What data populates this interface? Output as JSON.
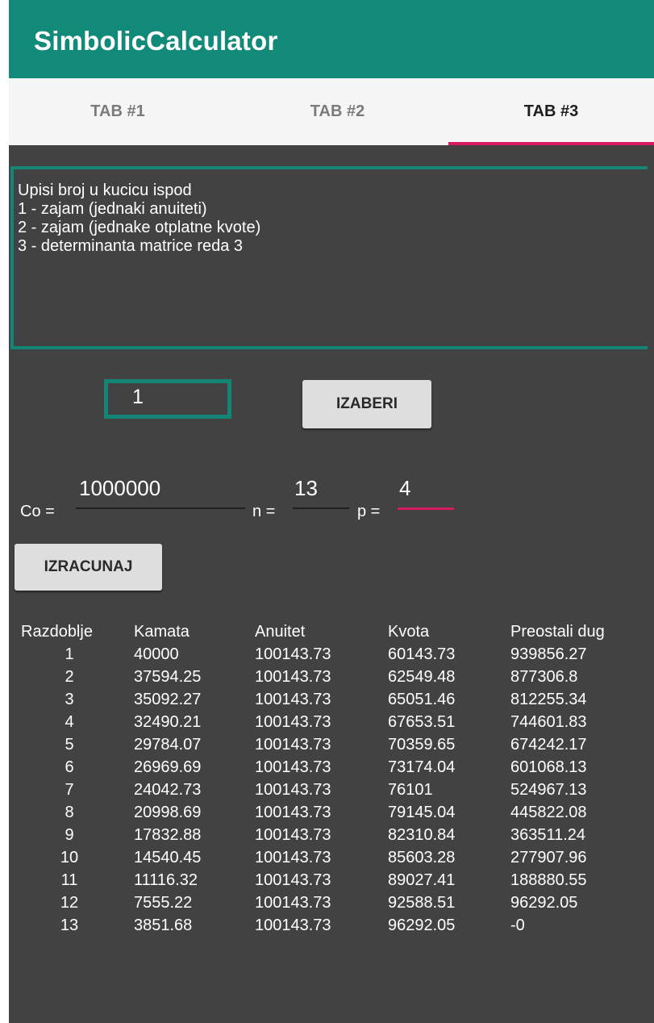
{
  "app": {
    "title": "SimbolicCalculator"
  },
  "tabs": [
    {
      "label": "TAB #1",
      "selected": false
    },
    {
      "label": "TAB #2",
      "selected": false
    },
    {
      "label": "TAB #3",
      "selected": true
    }
  ],
  "colors": {
    "app_bar": "#118a79",
    "tab_indicator": "#d81b60",
    "content_background": "#424242",
    "field_border": "#138577"
  },
  "instructions": {
    "lines": [
      "Upisi broj u kucicu ispod",
      "1 - zajam (jednaki anuiteti)",
      "2 - zajam (jednake otplatne kvote)",
      "3 - determinanta matrice reda 3"
    ]
  },
  "choice": {
    "value": "1"
  },
  "buttons": {
    "choose": "IZABERI",
    "calculate": "IZRACUNAJ"
  },
  "inputs": {
    "co": {
      "label": "Co =",
      "value": "1000000"
    },
    "n": {
      "label": "n =",
      "value": "13"
    },
    "p": {
      "label": "p =",
      "value": "4"
    }
  },
  "table": {
    "headers": [
      "Razdoblje",
      "Kamata",
      "Anuitet",
      "Kvota",
      "Preostali dug"
    ],
    "rows": [
      [
        "1",
        "40000",
        "100143.73",
        "60143.73",
        "939856.27"
      ],
      [
        "2",
        "37594.25",
        "100143.73",
        "62549.48",
        "877306.8"
      ],
      [
        "3",
        "35092.27",
        "100143.73",
        "65051.46",
        "812255.34"
      ],
      [
        "4",
        "32490.21",
        "100143.73",
        "67653.51",
        "744601.83"
      ],
      [
        "5",
        "29784.07",
        "100143.73",
        "70359.65",
        "674242.17"
      ],
      [
        "6",
        "26969.69",
        "100143.73",
        "73174.04",
        "601068.13"
      ],
      [
        "7",
        "24042.73",
        "100143.73",
        "76101",
        "524967.13"
      ],
      [
        "8",
        "20998.69",
        "100143.73",
        "79145.04",
        "445822.08"
      ],
      [
        "9",
        "17832.88",
        "100143.73",
        "82310.84",
        "363511.24"
      ],
      [
        "10",
        "14540.45",
        "100143.73",
        "85603.28",
        "277907.96"
      ],
      [
        "11",
        "11116.32",
        "100143.73",
        "89027.41",
        "188880.55"
      ],
      [
        "12",
        "7555.22",
        "100143.73",
        "92588.51",
        "96292.05"
      ],
      [
        "13",
        "3851.68",
        "100143.73",
        "96292.05",
        "-0"
      ]
    ]
  }
}
